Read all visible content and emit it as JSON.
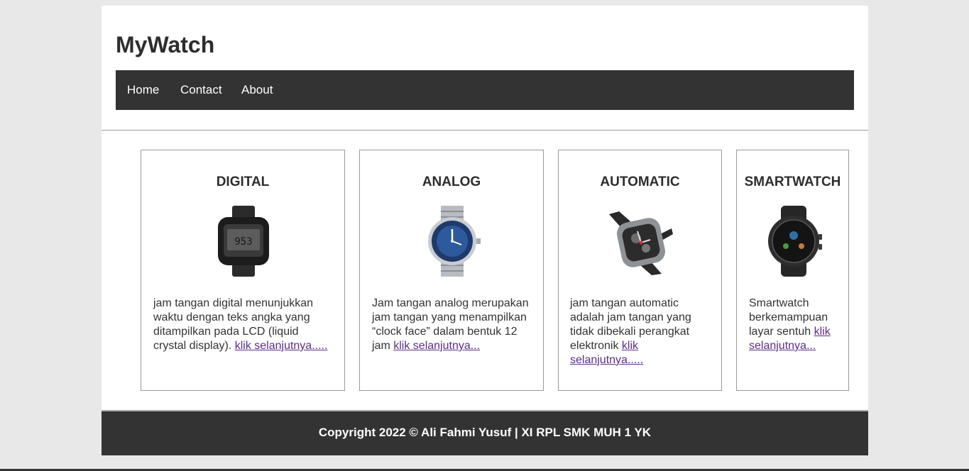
{
  "header": {
    "title": "MyWatch"
  },
  "nav": {
    "items": [
      "Home",
      "Contact",
      "About"
    ]
  },
  "cards": [
    {
      "title": "DIGITAL",
      "icon": "digital-watch-image",
      "text": "jam tangan digital menunjukkan waktu dengan teks angka yang ditampilkan pada LCD (liquid crystal display). ",
      "link": "klik selanjutnya.....",
      "display_time": "953"
    },
    {
      "title": "ANALOG",
      "icon": "analog-watch-image",
      "text": "Jam tangan analog merupakan jam tangan yang menampilkan “clock face” dalam bentuk 12 jam ",
      "link": "klik selanjutnya..."
    },
    {
      "title": "AUTOMATIC",
      "icon": "automatic-watch-image",
      "text": "jam tangan automatic adalah jam tangan yang tidak dibekali perangkat elektronik ",
      "link": "klik selanjutnya....."
    },
    {
      "title": "SMARTWATCH",
      "icon": "smartwatch-image",
      "text": "Smartwatch berkemampuan layar sentuh ",
      "link": "klik selanjutnya..."
    }
  ],
  "footer": {
    "text": "Copyright 2022 © Ali Fahmi Yusuf | XI RPL SMK MUH 1 YK"
  },
  "colors": {
    "nav_bg": "#333333",
    "link": "#5a2e8a",
    "page_bg": "#e8e8e8"
  }
}
